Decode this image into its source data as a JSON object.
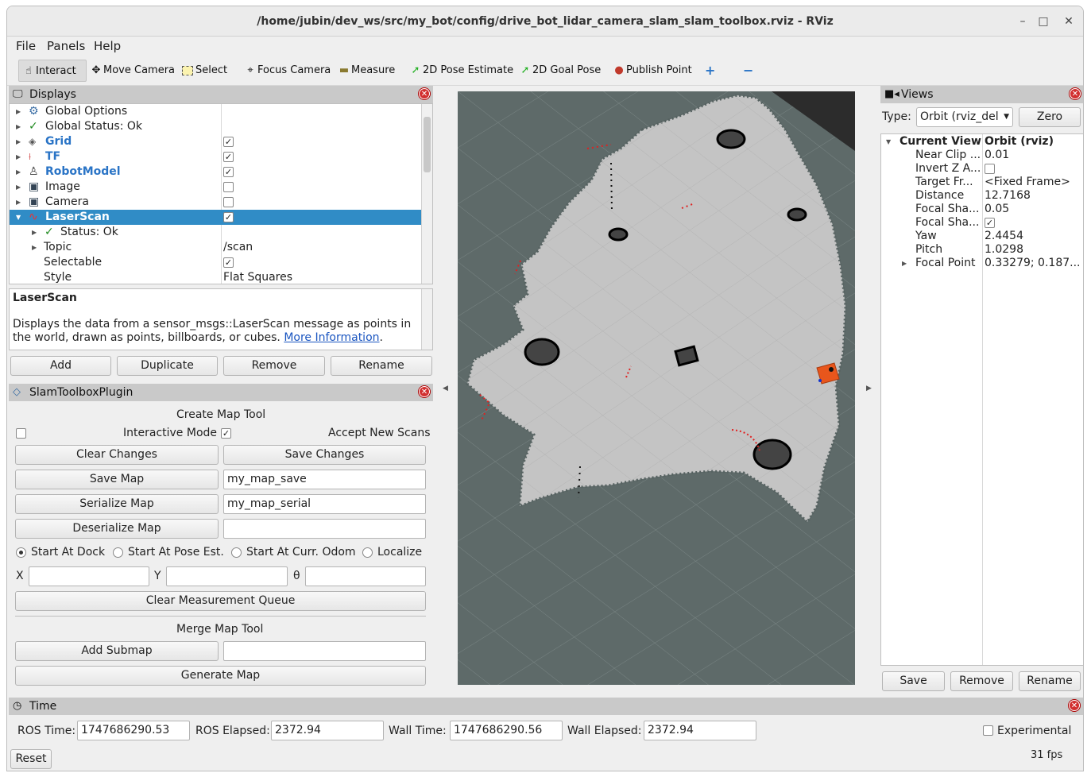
{
  "window": {
    "title": "/home/jubin/dev_ws/src/my_bot/config/drive_bot_lidar_camera_slam_slam_toolbox.rviz - RViz",
    "minimize": "–",
    "maximize": "□",
    "close": "✕"
  },
  "menu": [
    "File",
    "Panels",
    "Help"
  ],
  "toolbar": {
    "interact": "Interact",
    "move_camera": "Move Camera",
    "select": "Select",
    "focus_camera": "Focus Camera",
    "measure": "Measure",
    "pose_estimate": "2D Pose Estimate",
    "goal_pose": "2D Goal Pose",
    "publish_point": "Publish Point"
  },
  "displays": {
    "title": "Displays",
    "rows": [
      {
        "label": "Global Options"
      },
      {
        "label": "Global Status: Ok"
      },
      {
        "label": "Grid",
        "checked": true
      },
      {
        "label": "TF",
        "checked": true
      },
      {
        "label": "RobotModel",
        "checked": true
      },
      {
        "label": "Image",
        "checked": false
      },
      {
        "label": "Camera",
        "checked": false
      },
      {
        "label": "LaserScan",
        "checked": true
      },
      {
        "label": "Status: Ok"
      },
      {
        "label": "Topic",
        "value": "/scan"
      },
      {
        "label": "Selectable",
        "checked": true
      },
      {
        "label": "Style",
        "value": "Flat Squares"
      }
    ],
    "desc_title": "LaserScan",
    "desc_text": "Displays the data from a sensor_msgs::LaserScan message as points in the world, drawn as points, billboards, or cubes.",
    "desc_link": "More Information",
    "desc_end": ".",
    "buttons": {
      "add": "Add",
      "duplicate": "Duplicate",
      "remove": "Remove",
      "rename": "Rename"
    }
  },
  "slam": {
    "title": "SlamToolboxPlugin",
    "create_title": "Create Map Tool",
    "interactive_mode": "Interactive Mode",
    "accept_scans": "Accept New Scans",
    "clear_changes": "Clear Changes",
    "save_changes": "Save Changes",
    "save_map": "Save Map",
    "save_map_value": "my_map_save",
    "serialize_map": "Serialize Map",
    "serialize_value": "my_map_serial",
    "deserialize_map": "Deserialize Map",
    "radios": [
      "Start At Dock",
      "Start At Pose Est.",
      "Start At Curr. Odom",
      "Localize"
    ],
    "x": "X",
    "y": "Y",
    "theta": "θ",
    "clear_queue": "Clear Measurement Queue",
    "merge_title": "Merge Map Tool",
    "add_submap": "Add Submap",
    "generate_map": "Generate Map"
  },
  "views": {
    "title": "Views",
    "type_label": "Type:",
    "type_value": "Orbit (rviz_del",
    "zero": "Zero",
    "rows": [
      {
        "key": "Current View",
        "value": "Orbit (rviz)"
      },
      {
        "key": "Near Clip ...",
        "value": "0.01"
      },
      {
        "key": "Invert Z A...",
        "value": ""
      },
      {
        "key": "Target Fr...",
        "value": "<Fixed Frame>"
      },
      {
        "key": "Distance",
        "value": "12.7168"
      },
      {
        "key": "Focal Sha...",
        "value": "0.05"
      },
      {
        "key": "Focal Sha...",
        "value": ""
      },
      {
        "key": "Yaw",
        "value": "2.4454"
      },
      {
        "key": "Pitch",
        "value": "1.0298"
      },
      {
        "key": "Focal Point",
        "value": "0.33279; 0.187..."
      }
    ],
    "buttons": {
      "save": "Save",
      "remove": "Remove",
      "rename": "Rename"
    }
  },
  "time": {
    "title": "Time",
    "ros_time_label": "ROS Time:",
    "ros_time": "1747686290.53",
    "ros_elapsed_label": "ROS Elapsed:",
    "ros_elapsed": "2372.94",
    "wall_time_label": "Wall Time:",
    "wall_time": "1747686290.56",
    "wall_elapsed_label": "Wall Elapsed:",
    "wall_elapsed": "2372.94",
    "experimental": "Experimental",
    "reset": "Reset",
    "fps": "31 fps"
  },
  "colors": {
    "selection": "#308cc6",
    "viewport_bg": "#5e6a69",
    "map_free": "#c4c4c4",
    "robot": "#e8561c"
  }
}
